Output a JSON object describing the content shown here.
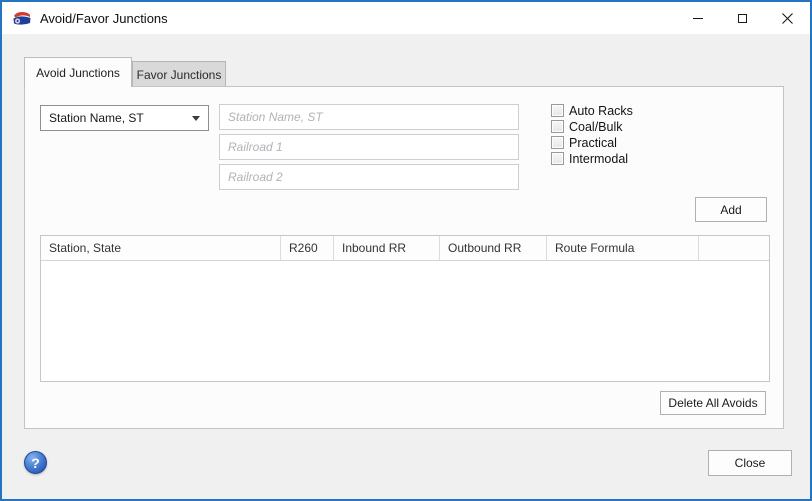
{
  "window": {
    "title": "Avoid/Favor Junctions"
  },
  "tabs": [
    {
      "label": "Avoid Junctions",
      "active": true
    },
    {
      "label": "Favor Junctions",
      "active": false
    }
  ],
  "form": {
    "junction_lookup": {
      "selected": "Station Name, ST"
    },
    "station_input": {
      "placeholder": "Station Name, ST",
      "value": ""
    },
    "railroad1_input": {
      "placeholder": "Railroad 1",
      "value": ""
    },
    "railroad2_input": {
      "placeholder": "Railroad 2",
      "value": ""
    },
    "checkboxes": [
      {
        "label": "Auto Racks",
        "checked": false
      },
      {
        "label": "Coal/Bulk",
        "checked": false
      },
      {
        "label": "Practical",
        "checked": false
      },
      {
        "label": "Intermodal",
        "checked": false
      }
    ],
    "add_button_label": "Add"
  },
  "table": {
    "columns": [
      "Station, State",
      "R260",
      "Inbound RR",
      "Outbound RR",
      "Route Formula",
      ""
    ],
    "rows": []
  },
  "actions": {
    "delete_all_label": "Delete All Avoids",
    "close_label": "Close"
  },
  "help": {
    "glyph": "?"
  },
  "colors": {
    "window_border_blue": "#2673bf",
    "titlebar_bg": "#ffffff",
    "dialog_bg": "#f0f0f1",
    "panel_bg": "#fcfcfc",
    "inactive_tab_bg": "#d9d9d9",
    "help_icon_blue": "#3a72c8",
    "placeholder_text": "#b2b2b8"
  }
}
